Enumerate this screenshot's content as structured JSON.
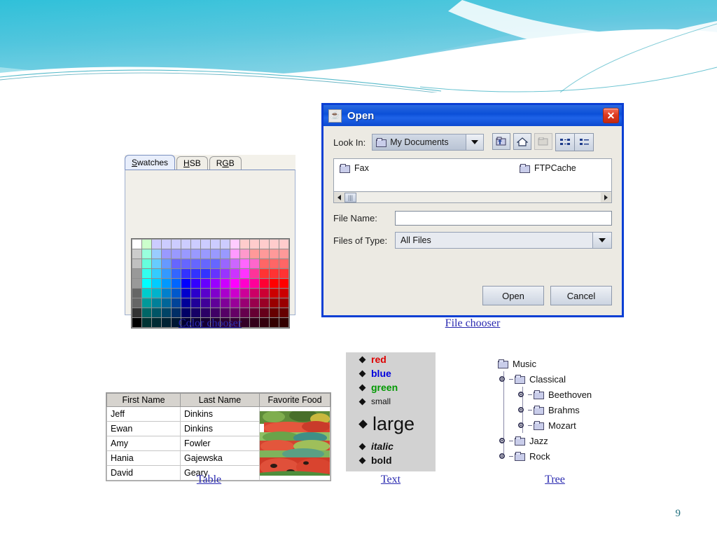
{
  "slide": {
    "number": "9",
    "theme_accent": "#28b8d4"
  },
  "captions": {
    "color_chooser": "Color chooser",
    "file_chooser": "File chooser",
    "table": "Table",
    "text": "Text",
    "tree": "Tree"
  },
  "color_chooser": {
    "tabs": [
      {
        "label": "Swatches",
        "mnemonic": "S",
        "selected": true
      },
      {
        "label": "HSB",
        "mnemonic": "H",
        "selected": false
      },
      {
        "label": "RGB",
        "mnemonic": "G",
        "selected": false
      }
    ],
    "swatch_rows": [
      [
        "#ffffff",
        "#ccffcc",
        "#ccccff",
        "#ccccff",
        "#ccccff",
        "#ccccff",
        "#ccccff",
        "#ccccff",
        "#ccccff",
        "#ccccff",
        "#ffccff",
        "#ffcccc",
        "#ffcccc",
        "#ffcccc",
        "#ffcccc",
        "#ffcccc"
      ],
      [
        "#cccccc",
        "#99ffdd",
        "#99ccff",
        "#9999ff",
        "#9999ff",
        "#9999ff",
        "#9999ff",
        "#9999ff",
        "#9999ff",
        "#9999ff",
        "#ff99ff",
        "#ff99cc",
        "#ff9999",
        "#ff9999",
        "#ff9999",
        "#ff9999"
      ],
      [
        "#c0c0c0",
        "#66ffdd",
        "#66ccff",
        "#6699ff",
        "#6666ff",
        "#6666ff",
        "#6666ff",
        "#6666ff",
        "#6666ff",
        "#9966ff",
        "#cc66ff",
        "#ff66ff",
        "#ff66cc",
        "#ff6666",
        "#ff6666",
        "#ff6666"
      ],
      [
        "#999999",
        "#33ffee",
        "#33ccff",
        "#3399ff",
        "#3366ff",
        "#3333ff",
        "#3333ff",
        "#3333ff",
        "#6633ff",
        "#9933ff",
        "#cc33ff",
        "#ff33ff",
        "#ff3399",
        "#ff3333",
        "#ff3333",
        "#ff3333"
      ],
      [
        "#999999",
        "#00ffff",
        "#00ccff",
        "#0099ff",
        "#0066ff",
        "#0000ff",
        "#3300ff",
        "#6600ff",
        "#9900ff",
        "#cc00ff",
        "#ff00ff",
        "#ff00cc",
        "#ff0099",
        "#ff0033",
        "#ff0000",
        "#ff0000"
      ],
      [
        "#666666",
        "#00cccc",
        "#00b3cc",
        "#0080cc",
        "#0059cc",
        "#0000cc",
        "#2b00cc",
        "#5900cc",
        "#8000cc",
        "#aa00cc",
        "#cc00cc",
        "#cc0099",
        "#cc0066",
        "#cc0033",
        "#cc0000",
        "#cc0000"
      ],
      [
        "#666666",
        "#009999",
        "#008099",
        "#006699",
        "#004499",
        "#000099",
        "#200099",
        "#400099",
        "#600099",
        "#800099",
        "#990099",
        "#990073",
        "#99004d",
        "#990026",
        "#990000",
        "#990000"
      ],
      [
        "#333333",
        "#006666",
        "#005566",
        "#004466",
        "#002e66",
        "#000066",
        "#160066",
        "#2b0066",
        "#400066",
        "#560066",
        "#660066",
        "#66004d",
        "#660033",
        "#66001a",
        "#660000",
        "#660000"
      ],
      [
        "#000000",
        "#003333",
        "#002b33",
        "#002233",
        "#001733",
        "#000033",
        "#0b0033",
        "#160033",
        "#200033",
        "#2b0033",
        "#330033",
        "#330026",
        "#33001a",
        "#33000d",
        "#330000",
        "#330000"
      ]
    ]
  },
  "file_chooser": {
    "title": "Open",
    "title_icon": "java-coffee-cup-icon",
    "close_label": "✕",
    "look_in_label": "Look In:",
    "look_in_value": "My Documents",
    "toolbar": [
      {
        "name": "up-one-level-button",
        "enabled": true
      },
      {
        "name": "home-button",
        "enabled": true
      },
      {
        "name": "new-folder-button",
        "enabled": false
      },
      {
        "name": "list-view-button",
        "enabled": true
      },
      {
        "name": "details-view-button",
        "enabled": true
      }
    ],
    "files": [
      "Fax",
      "FTPCache"
    ],
    "file_name_label": "File Name:",
    "file_name_value": "",
    "files_of_type_label": "Files of Type:",
    "files_of_type_value": "All Files",
    "buttons": [
      {
        "label": "Open",
        "name": "open-button"
      },
      {
        "label": "Cancel",
        "name": "cancel-button"
      }
    ]
  },
  "table_demo": {
    "columns": [
      "First Name",
      "Last Name",
      "Favorite Food"
    ],
    "rows": [
      {
        "first": "Jeff",
        "last": "Dinkins"
      },
      {
        "first": "Ewan",
        "last": "Dinkins"
      },
      {
        "first": "Amy",
        "last": "Fowler"
      },
      {
        "first": "Hania",
        "last": "Gajewska"
      },
      {
        "first": "David",
        "last": "Geary"
      }
    ],
    "food_image_alt": "watermelon-and-vegetables-photo"
  },
  "text_demo": {
    "items": [
      {
        "text": "red",
        "style": "t-red"
      },
      {
        "text": "blue",
        "style": "t-blue"
      },
      {
        "text": "green",
        "style": "t-green"
      },
      {
        "text": "small",
        "style": "t-small"
      },
      {
        "text": "large",
        "style": "t-large"
      },
      {
        "text": "italic",
        "style": "t-italic"
      },
      {
        "text": "bold",
        "style": "t-bold"
      }
    ]
  },
  "tree_demo": {
    "root": "Music",
    "nodes": [
      {
        "label": "Classical",
        "level": 1
      },
      {
        "label": "Beethoven",
        "level": 2
      },
      {
        "label": "Brahms",
        "level": 2
      },
      {
        "label": "Mozart",
        "level": 2
      },
      {
        "label": "Jazz",
        "level": 1
      },
      {
        "label": "Rock",
        "level": 1
      }
    ]
  }
}
